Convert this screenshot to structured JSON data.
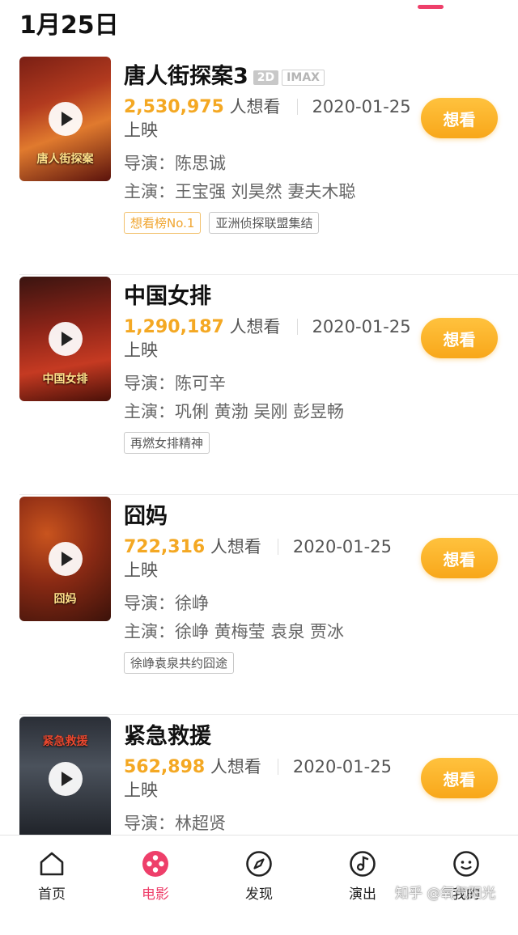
{
  "date_header": "1月25日",
  "movies": [
    {
      "title": "唐人街探案3",
      "formats": [
        "2D",
        "IMAX"
      ],
      "wish_count": "2,530,975",
      "wish_suffix": "人想看",
      "release": "2020-01-25 上映",
      "director": "导演：陈思诚",
      "cast": "主演：王宝强 刘昊然 妻夫木聪",
      "chips": [
        "想看榜No.1",
        "亚洲侦探联盟集结"
      ],
      "button": "想看",
      "poster_text": "唐人街探案"
    },
    {
      "title": "中国女排",
      "formats": [],
      "wish_count": "1,290,187",
      "wish_suffix": "人想看",
      "release": "2020-01-25 上映",
      "director": "导演：陈可辛",
      "cast": "主演：巩俐 黄渤 吴刚 彭昱畅",
      "chips": [
        "再燃女排精神"
      ],
      "button": "想看",
      "poster_text": "中国女排"
    },
    {
      "title": "囧妈",
      "formats": [],
      "wish_count": "722,316",
      "wish_suffix": "人想看",
      "release": "2020-01-25 上映",
      "director": "导演：徐峥",
      "cast": "主演：徐峥 黄梅莹 袁泉 贾冰",
      "chips": [
        "徐峥袁泉共约囧途"
      ],
      "button": "想看",
      "poster_text": "囧妈"
    },
    {
      "title": "紧急救援",
      "formats": [],
      "wish_count": "562,898",
      "wish_suffix": "人想看",
      "release": "2020-01-25 上映",
      "director": "导演：林超贤",
      "cast": "",
      "chips": [],
      "button": "想看",
      "poster_text": "紧急救援"
    }
  ],
  "tabs": [
    {
      "label": "首页",
      "icon": "home-icon"
    },
    {
      "label": "电影",
      "icon": "film-reel-icon"
    },
    {
      "label": "发现",
      "icon": "compass-icon"
    },
    {
      "label": "演出",
      "icon": "music-note-icon"
    },
    {
      "label": "我的",
      "icon": "smiley-icon"
    }
  ],
  "active_tab": "电影",
  "watermark": "知乎 @氧气阳光",
  "colors": {
    "accent": "#ee3f6a",
    "wish_count": "#f4a823",
    "button_bg": "#f8a71a"
  }
}
